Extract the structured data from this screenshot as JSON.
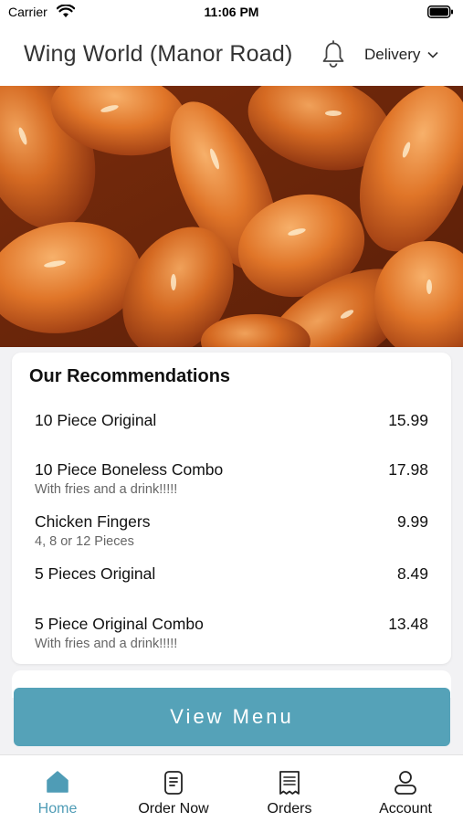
{
  "status_bar": {
    "carrier": "Carrier",
    "time": "11:06 PM"
  },
  "header": {
    "title": "Wing World (Manor Road)",
    "order_mode": "Delivery"
  },
  "recommendations": {
    "title": "Our Recommendations",
    "items": [
      {
        "name": "10 Piece Original",
        "price": "15.99",
        "description": ""
      },
      {
        "name": "10 Piece Boneless Combo",
        "price": "17.98",
        "description": "With fries and a drink!!!!!"
      },
      {
        "name": "Chicken Fingers",
        "price": "9.99",
        "description": "4, 8 or 12 Pieces"
      },
      {
        "name": "5 Pieces Original",
        "price": "8.49",
        "description": ""
      },
      {
        "name": "5 Piece Original Combo",
        "price": "13.48",
        "description": "With fries and a drink!!!!!"
      }
    ]
  },
  "view_menu_label": "View Menu",
  "tabs": [
    {
      "label": "Home",
      "icon": "home-icon",
      "active": true
    },
    {
      "label": "Order Now",
      "icon": "order-now-icon",
      "active": false
    },
    {
      "label": "Orders",
      "icon": "receipt-icon",
      "active": false
    },
    {
      "label": "Account",
      "icon": "person-icon",
      "active": false
    }
  ],
  "colors": {
    "accent": "#55a2b8",
    "active_tab": "#4f9cb6",
    "background": "#f2f2f4"
  }
}
